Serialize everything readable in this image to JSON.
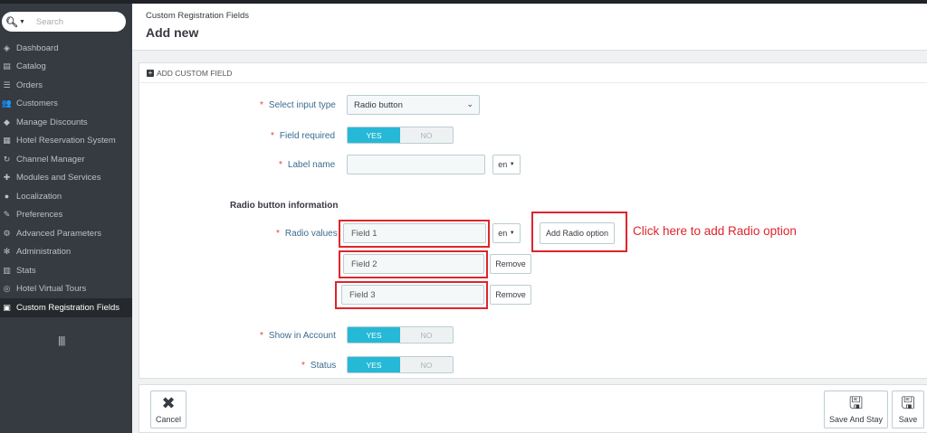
{
  "sidebar": {
    "search_placeholder": "Search",
    "items": [
      {
        "label": "Dashboard",
        "icon": "dashboard-icon",
        "glyph": "◈"
      },
      {
        "label": "Catalog",
        "icon": "catalog-icon",
        "glyph": "▤"
      },
      {
        "label": "Orders",
        "icon": "orders-icon",
        "glyph": "☰"
      },
      {
        "label": "Customers",
        "icon": "customers-icon",
        "glyph": "👥"
      },
      {
        "label": "Manage Discounts",
        "icon": "tag-icon",
        "glyph": "◆"
      },
      {
        "label": "Hotel Reservation System",
        "icon": "building-icon",
        "glyph": "▦"
      },
      {
        "label": "Channel Manager",
        "icon": "refresh-icon",
        "glyph": "↻"
      },
      {
        "label": "Modules and Services",
        "icon": "puzzle-icon",
        "glyph": "✚"
      },
      {
        "label": "Localization",
        "icon": "globe-icon",
        "glyph": "●"
      },
      {
        "label": "Preferences",
        "icon": "wrench-icon",
        "glyph": "✎"
      },
      {
        "label": "Advanced Parameters",
        "icon": "cogs-icon",
        "glyph": "⚙"
      },
      {
        "label": "Administration",
        "icon": "gear-icon",
        "glyph": "✻"
      },
      {
        "label": "Stats",
        "icon": "bar-chart-icon",
        "glyph": "▥"
      },
      {
        "label": "Hotel Virtual Tours",
        "icon": "compass-icon",
        "glyph": "◎"
      },
      {
        "label": "Custom Registration Fields",
        "icon": "file-icon",
        "glyph": "▣"
      }
    ],
    "active_index": 14,
    "collapse_glyph": "||||"
  },
  "header": {
    "breadcrumb": "Custom Registration Fields",
    "title": "Add new"
  },
  "panel": {
    "heading": "ADD CUSTOM FIELD",
    "input_type_label": "Select input type",
    "input_type_value": "Radio button",
    "field_required_label": "Field required",
    "label_name_label": "Label name",
    "label_name_value": "",
    "lang": "en",
    "section_title": "Radio button information",
    "radio_values_label": "Radio values",
    "radio_values": [
      "Field 1",
      "Field 2",
      "Field 3"
    ],
    "add_radio_label": "Add Radio option",
    "remove_label": "Remove",
    "show_in_account_label": "Show in Account",
    "status_label": "Status",
    "yes": "YES",
    "no": "NO"
  },
  "annotation": {
    "text": "Click here to add Radio option",
    "color": "#e0242b"
  },
  "footer": {
    "cancel_label": "Cancel",
    "save_stay_label": "Save And Stay",
    "save_label": "Save"
  },
  "colors": {
    "accent": "#25b9d7",
    "sidebar_bg": "#363a41",
    "required": "#e0413c"
  }
}
